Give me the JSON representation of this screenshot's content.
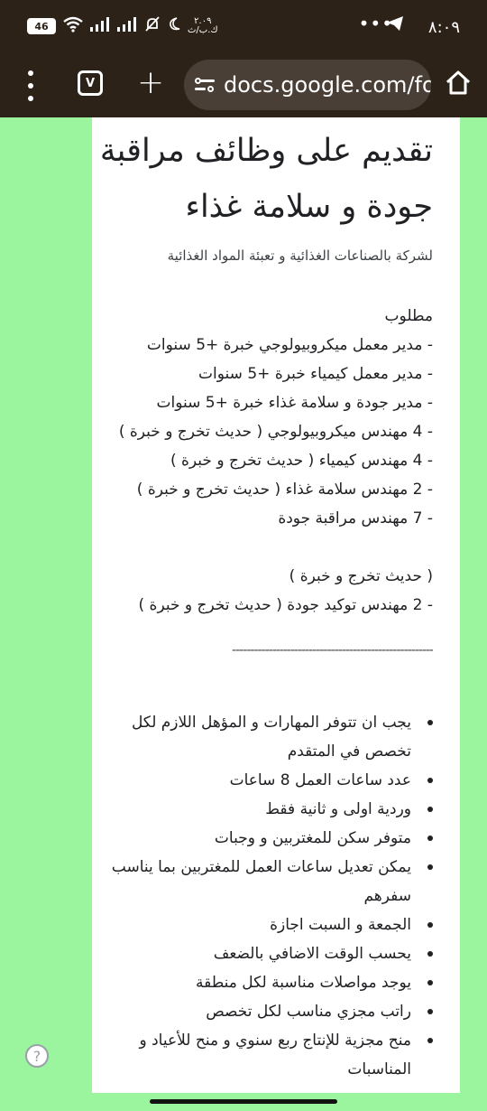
{
  "status": {
    "time": "٨:٠٩",
    "battery": "46",
    "data_rate": "٢.٠٩\nك.ب/ث",
    "dots": "•••"
  },
  "browser": {
    "url": "docs.google.com/fo",
    "tab_count": "V"
  },
  "doc": {
    "title_line1": "تقديم على وظائف مراقبة",
    "title_line2": "جودة و سلامة غذاء",
    "subtitle": "لشركة بالصناعات الغذائية و تعبئة المواد الغذائية",
    "required_header": "مطلوب",
    "jobs": [
      "- مدير معمل ميكروبيولوجي خبرة +5 سنوات",
      "- مدير معمل كيمياء خبرة +5 سنوات",
      "- مدير جودة و سلامة غذاء خبرة +5 سنوات",
      "- 4 مهندس ميكروبيولوجي ( حديث تخرج و خبرة )",
      "- 4 مهندس كيمياء ( حديث تخرج و خبرة )",
      "- 2 مهندس سلامة غذاء ( حديث تخرج و خبرة )",
      "- 7 مهندس مراقبة جودة"
    ],
    "jobs_extra": [
      "( حديث تخرج و خبرة )",
      "- 2 مهندس توكيد جودة ( حديث تخرج و خبرة )"
    ],
    "separator": "-------------------------------------------------------",
    "conditions": [
      "يجب ان تتوفر المهارات و المؤهل اللازم لكل تخصص في المتقدم",
      "عدد ساعات العمل 8 ساعات",
      "وردية اولى و ثانية فقط",
      "متوفر سكن للمغتربين و وجبات",
      "يمكن تعديل ساعات العمل للمغتربين بما يناسب سفرهم",
      "الجمعة و السبت اجازة",
      "يحسب الوقت الاضافي بالضعف",
      "يوجد مواصلات مناسبة لكل منطقة",
      "راتب مجزي مناسب لكل تخصص",
      "منح مجزية للإنتاج ربع سنوي و منح للأعياد و المناسبات"
    ]
  },
  "help": "?",
  "colors": {
    "background": "#9af59e",
    "chrome": "#2d2218",
    "address_bar": "#4a3f36"
  }
}
